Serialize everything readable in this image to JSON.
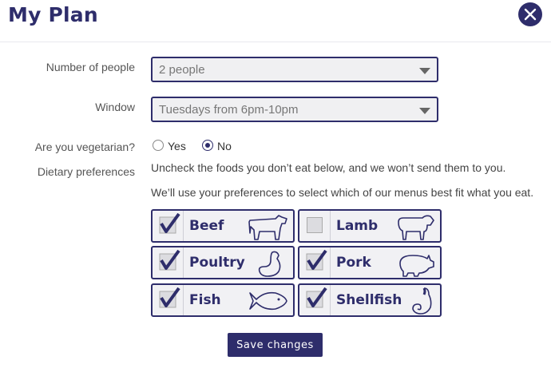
{
  "header": {
    "title": "My Plan"
  },
  "form": {
    "people_label": "Number of people",
    "people_value": "2 people",
    "window_label": "Window",
    "window_value": "Tuesdays from 6pm-10pm",
    "vegetarian_label": "Are you vegetarian?",
    "vegetarian_options": [
      {
        "label": "Yes",
        "selected": false
      },
      {
        "label": "No",
        "selected": true
      }
    ],
    "dietary_label": "Dietary preferences",
    "dietary_text_1": "Uncheck the foods you don’t eat below, and we won’t send them to you.",
    "dietary_text_2": "We’ll use your preferences to select which of our menus best fit what you eat.",
    "foods": [
      {
        "name": "Beef",
        "checked": true,
        "icon": "cow-icon"
      },
      {
        "name": "Lamb",
        "checked": false,
        "icon": "sheep-icon"
      },
      {
        "name": "Poultry",
        "checked": true,
        "icon": "chicken-icon"
      },
      {
        "name": "Pork",
        "checked": true,
        "icon": "pig-icon"
      },
      {
        "name": "Fish",
        "checked": true,
        "icon": "fish-icon"
      },
      {
        "name": "Shellfish",
        "checked": true,
        "icon": "shrimp-icon"
      }
    ],
    "save_label": "Save changes"
  },
  "colors": {
    "accent": "#2e2d6b",
    "tile_bg": "#f1f1f4"
  }
}
